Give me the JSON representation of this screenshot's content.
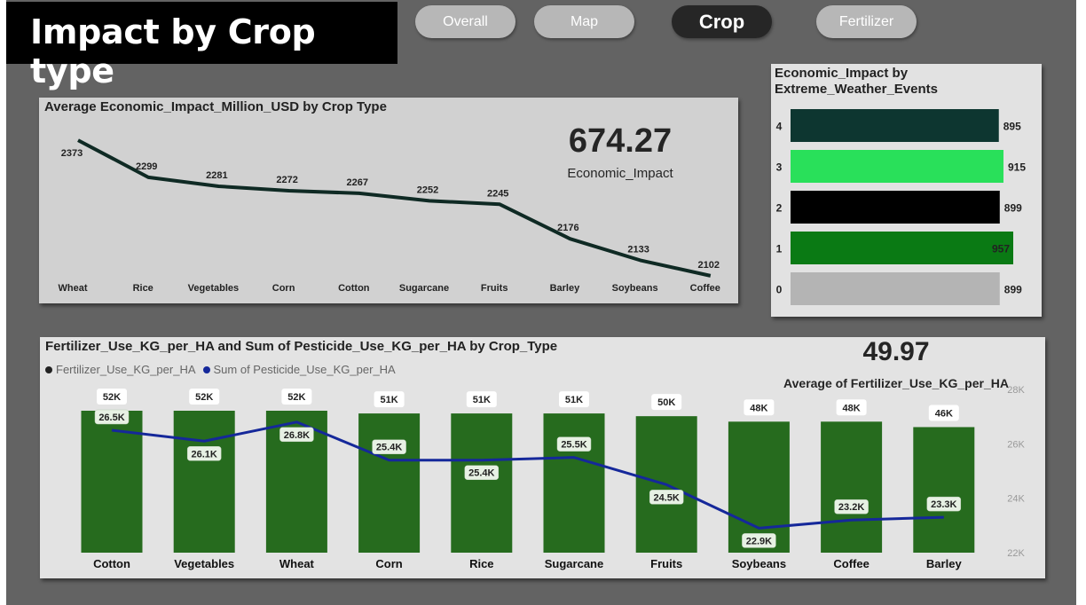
{
  "header": {
    "title": "Impact by Crop type"
  },
  "nav": {
    "items": [
      {
        "label": "Overall",
        "active": false
      },
      {
        "label": "Map",
        "active": false
      },
      {
        "label": "Crop",
        "active": true
      },
      {
        "label": "Fertilizer",
        "active": false
      }
    ]
  },
  "line_panel": {
    "title": "Average Economic_Impact_Million_USD by Crop Type",
    "kpi_value": "674.27",
    "kpi_label": "Economic_Impact"
  },
  "hbar_panel": {
    "title_line1": "Economic_Impact by",
    "title_line2": "Extreme_Weather_Events"
  },
  "combo_panel": {
    "title": "Fertilizer_Use_KG_per_HA and Sum of Pesticide_Use_KG_per_HA by Crop_Type",
    "legend_bar": "Fertilizer_Use_KG_per_HA",
    "legend_line": "Sum of Pesticide_Use_KG_per_HA",
    "kpi_value": "49.97",
    "kpi_label": "Average of Fertilizer_Use_KG_per_HA"
  },
  "colors": {
    "line": "#0f2a24",
    "bar_green": "#266b1e",
    "pesticide_line": "#15289a",
    "hbar": [
      "#b4b4b4",
      "#0a7a14",
      "#000000",
      "#29e05a",
      "#0d3630"
    ]
  },
  "chart_data": [
    {
      "type": "line",
      "title": "Average Economic_Impact_Million_USD by Crop Type",
      "categories": [
        "Wheat",
        "Rice",
        "Vegetables",
        "Corn",
        "Cotton",
        "Sugarcane",
        "Fruits",
        "Barley",
        "Soybeans",
        "Coffee"
      ],
      "values": [
        2373,
        2299,
        2281,
        2272,
        2267,
        2252,
        2245,
        2176,
        2133,
        2102
      ],
      "data_labels": [
        "2373",
        "2299",
        "2281",
        "2272",
        "2267",
        "2252",
        "2245",
        "2176",
        "2133",
        "2102"
      ],
      "ylim": [
        2100,
        2375
      ]
    },
    {
      "type": "bar",
      "orientation": "horizontal",
      "title": "Economic_Impact by Extreme_Weather_Events",
      "categories": [
        "4",
        "3",
        "2",
        "1",
        "0"
      ],
      "values": [
        895,
        915,
        899,
        957,
        899
      ],
      "data_labels": [
        "895",
        "915",
        "899",
        "957",
        "899"
      ],
      "xlim": [
        0,
        957
      ]
    },
    {
      "type": "bar",
      "title": "Fertilizer_Use_KG_per_HA and Sum of Pesticide_Use_KG_per_HA by Crop_Type",
      "categories": [
        "Cotton",
        "Vegetables",
        "Wheat",
        "Corn",
        "Rice",
        "Sugarcane",
        "Fruits",
        "Soybeans",
        "Coffee",
        "Barley"
      ],
      "series": [
        {
          "name": "Fertilizer_Use_KG_per_HA",
          "kind": "bar",
          "values": [
            52000,
            52000,
            52000,
            51000,
            51000,
            51000,
            50000,
            48000,
            48000,
            46000
          ],
          "data_labels": [
            "52K",
            "52K",
            "52K",
            "51K",
            "51K",
            "51K",
            "50K",
            "48K",
            "48K",
            "46K"
          ]
        },
        {
          "name": "Sum of Pesticide_Use_KG_per_HA",
          "kind": "line",
          "axis": "right",
          "values": [
            26500,
            26100,
            26800,
            25400,
            25400,
            25500,
            24500,
            22900,
            23200,
            23300
          ],
          "data_labels": [
            "26.5K",
            "26.1K",
            "26.8K",
            "25.4K",
            "25.4K",
            "25.5K",
            "24.5K",
            "22.9K",
            "23.2K",
            "23.3K"
          ]
        }
      ],
      "y2_ticks": [
        "22K",
        "24K",
        "26K",
        "28K"
      ],
      "y2lim": [
        22000,
        28000
      ]
    }
  ]
}
